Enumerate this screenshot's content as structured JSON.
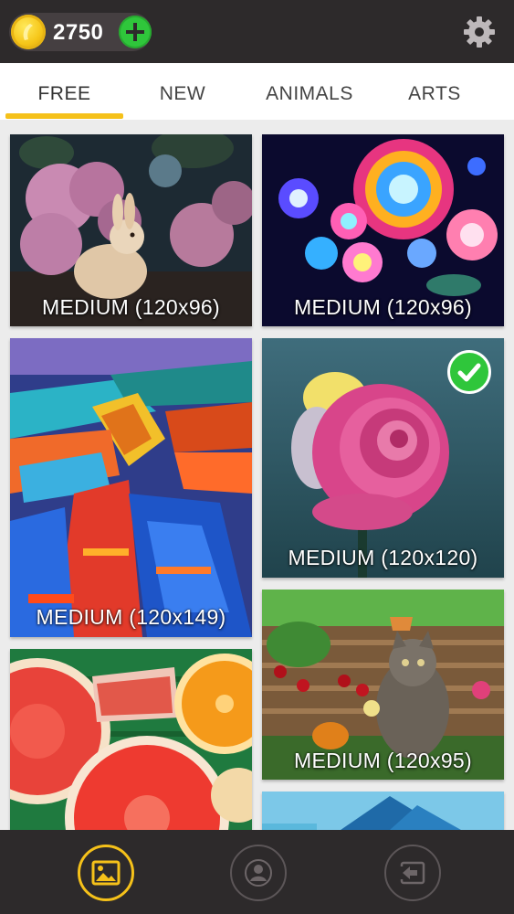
{
  "header": {
    "coins": "2750",
    "coin_icon": "coin-icon",
    "add_icon": "plus-icon",
    "settings_icon": "gear-icon"
  },
  "tabs": [
    {
      "label": "FREE",
      "active": true
    },
    {
      "label": "NEW",
      "active": false
    },
    {
      "label": "ANIMALS",
      "active": false
    },
    {
      "label": "ARTS",
      "active": false
    }
  ],
  "cards": [
    {
      "subject": "bunny-flowers",
      "label": "MEDIUM (120x96)",
      "completed": false
    },
    {
      "subject": "neon-flowers",
      "label": "MEDIUM (120x96)",
      "completed": false
    },
    {
      "subject": "painted-boats",
      "label": "MEDIUM (120x149)",
      "completed": false
    },
    {
      "subject": "pink-rose",
      "label": "MEDIUM (120x120)",
      "completed": true
    },
    {
      "subject": "grapefruit-orange",
      "label": "",
      "completed": false
    },
    {
      "subject": "kitten-garden",
      "label": "MEDIUM (120x95)",
      "completed": false
    },
    {
      "subject": "blue-landscape",
      "label": "",
      "completed": false
    }
  ],
  "bottom_nav": [
    {
      "name": "gallery",
      "icon": "gallery-icon",
      "active": true
    },
    {
      "name": "profile",
      "icon": "profile-icon",
      "active": false
    },
    {
      "name": "exit",
      "icon": "exit-icon",
      "active": false
    }
  ],
  "colors": {
    "header_bg": "#2d2a2b",
    "accent": "#f5c11a",
    "add_green": "#2fc63b",
    "tab_bg": "#ffffff",
    "grid_bg": "#ececec"
  }
}
